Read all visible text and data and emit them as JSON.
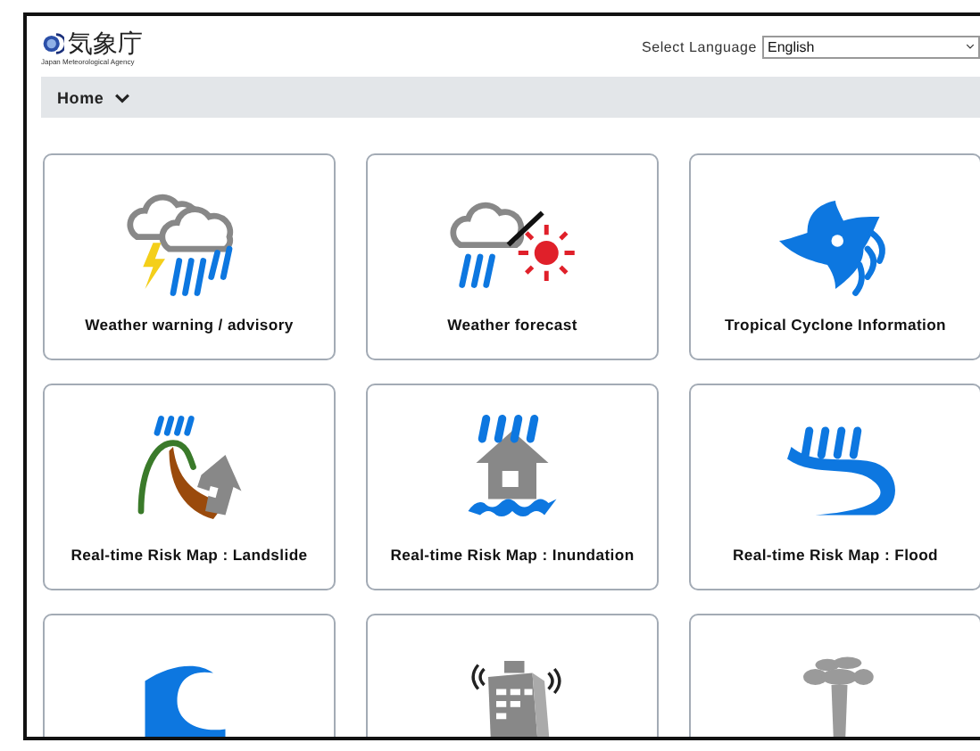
{
  "header": {
    "logo_text": "気象庁",
    "logo_subtitle": "Japan Meteorological Agency",
    "language_label": "Select Language",
    "language_value": "English"
  },
  "nav": {
    "label": "Home"
  },
  "tiles": [
    {
      "label": "Weather warning / advisory",
      "kind": "storm"
    },
    {
      "label": "Weather forecast",
      "kind": "forecast"
    },
    {
      "label": "Tropical Cyclone Information",
      "kind": "cyclone"
    },
    {
      "label": "Real-time Risk Map : Landslide",
      "kind": "landslide"
    },
    {
      "label": "Real-time Risk Map : Inundation",
      "kind": "inundation"
    },
    {
      "label": "Real-time Risk Map : Flood",
      "kind": "flood"
    },
    {
      "kind": "tsunami"
    },
    {
      "kind": "earthquake"
    },
    {
      "kind": "volcano"
    }
  ]
}
